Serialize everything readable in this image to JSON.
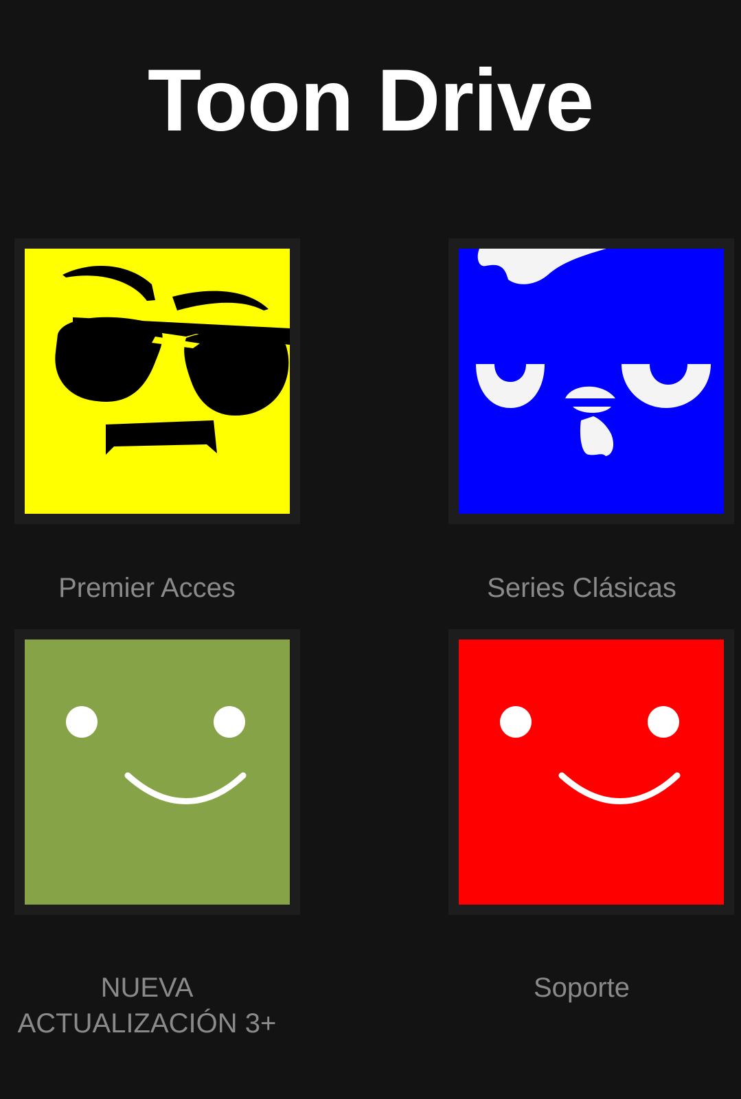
{
  "app": {
    "title": "Toon Drive"
  },
  "tiles": [
    {
      "label": "Premier Acces",
      "color": "#ffff00",
      "icon": "sunglasses-face-icon"
    },
    {
      "label": "Series Clásicas",
      "color": "#0000ff",
      "icon": "sleepy-bird-face-icon"
    },
    {
      "label": "NUEVA ACTUALIZACIÓN 3+",
      "color": "#86a447",
      "icon": "smiley-face-icon"
    },
    {
      "label": "Soporte",
      "color": "#ff0000",
      "icon": "smiley-face-icon"
    }
  ],
  "theme": {
    "background": "#131313",
    "tile_frame": "#1d1d1d",
    "title_color": "#ffffff",
    "label_color": "#8a8a8a"
  }
}
